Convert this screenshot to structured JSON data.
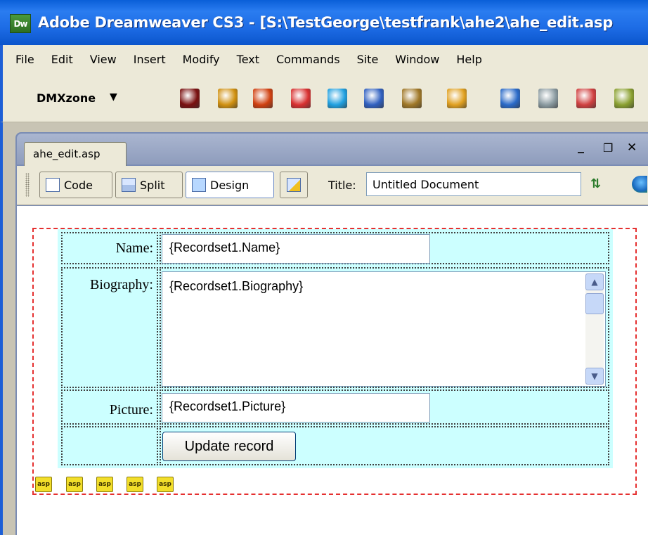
{
  "window": {
    "app_icon": "Dw",
    "title": "Adobe Dreamweaver CS3 - [S:\\TestGeorge\\testfrank\\ahe2\\ahe_edit.asp"
  },
  "menu": [
    "File",
    "Edit",
    "View",
    "Insert",
    "Modify",
    "Text",
    "Commands",
    "Site",
    "Window",
    "Help"
  ],
  "insert_bar": {
    "category": "DMXzone",
    "dropdown_icon": "triangle-down-icon",
    "tools": [
      {
        "name": "pro-icon",
        "color": "#7a1010"
      },
      {
        "name": "flower-icon",
        "color": "#d09010"
      },
      {
        "name": "book-icon",
        "color": "#d04010"
      },
      {
        "name": "red-card-icon",
        "color": "#d83030"
      },
      {
        "name": "play-icon",
        "color": "#20a0e0"
      },
      {
        "name": "photo-icon",
        "color": "#3060c0"
      },
      {
        "name": "gallery-icon",
        "color": "#a07828"
      },
      {
        "name": "pie-icon",
        "color": "#e0a020"
      },
      {
        "name": "rss-icon",
        "color": "#2a6ac8"
      },
      {
        "name": "gear-icon",
        "color": "#8a9aa0"
      },
      {
        "name": "page-icon",
        "color": "#d04040"
      },
      {
        "name": "book-green-icon",
        "color": "#8aa030"
      }
    ]
  },
  "document": {
    "tab_label": "ahe_edit.asp",
    "window_controls": {
      "minimize": "_",
      "restore": "❐",
      "close": "✕"
    },
    "views": {
      "code": "Code",
      "split": "Split",
      "design": "Design"
    },
    "title_label": "Title:",
    "title_value": "Untitled Document"
  },
  "form": {
    "name_label": "Name:",
    "name_value": "{Recordset1.Name}",
    "biography_label": "Biography:",
    "biography_value": "{Recordset1.Biography}",
    "picture_label": "Picture:",
    "picture_value": "{Recordset1.Picture}",
    "submit_label": "Update record",
    "asp_markers": [
      "asp",
      "asp",
      "asp",
      "asp",
      "asp"
    ]
  }
}
